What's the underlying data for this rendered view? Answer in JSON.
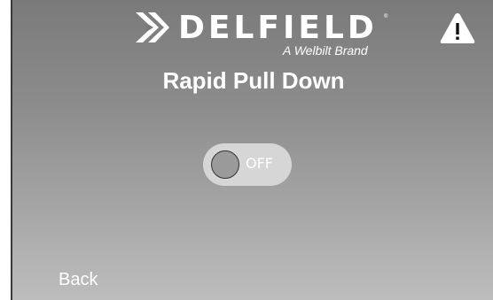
{
  "header": {
    "brand_name": "DELFIELD",
    "brand_tagline": "A Welbilt Brand",
    "brand_registered": "®",
    "warning_icon": "warning-triangle-icon"
  },
  "main": {
    "title": "Rapid Pull Down",
    "toggle": {
      "state": "OFF",
      "is_on": false
    }
  },
  "footer": {
    "back_label": "Back"
  },
  "colors": {
    "text": "#ffffff",
    "background_top": "#7a7a7a",
    "background_bottom": "#bdbdbd",
    "toggle_track": "#d6d6d6",
    "toggle_knob": "#9a9a9a"
  }
}
